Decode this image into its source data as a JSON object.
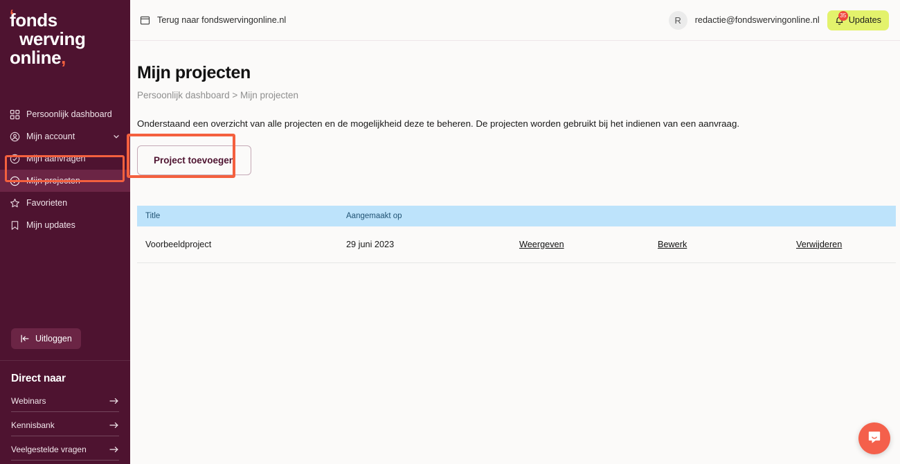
{
  "sidebar": {
    "logo": {
      "line1": "fonds",
      "line2": "werving",
      "line3": "online",
      "comma": ","
    },
    "nav": [
      {
        "label": "Persoonlijk dashboard",
        "icon": "grid-icon"
      },
      {
        "label": "Mijn account",
        "icon": "user-circle-icon",
        "chevron": "chevron-down-icon"
      },
      {
        "label": "Mijn aanvragen",
        "icon": "check-circle-icon"
      },
      {
        "label": "Mijn projecten",
        "icon": "check-circle-icon",
        "active": true
      },
      {
        "label": "Favorieten",
        "icon": "star-icon"
      },
      {
        "label": "Mijn updates",
        "icon": "bookmark-icon"
      }
    ],
    "logout_label": "Uitloggen",
    "direct_title": "Direct naar",
    "direct_links": [
      {
        "label": "Webinars"
      },
      {
        "label": "Kennisbank"
      },
      {
        "label": "Veelgestelde vragen"
      }
    ],
    "colors": {
      "background": "#4e1330",
      "active": "#6b2545",
      "accent": "#f4603e"
    }
  },
  "topbar": {
    "back_label": "Terug naar fondswervingonline.nl",
    "avatar_initial": "R",
    "user_email": "redactie@fondswervingonline.nl",
    "updates_label": "Updates",
    "updates_badge": "35",
    "updates_color": "#e3f26c",
    "badge_color": "#f0483c"
  },
  "main": {
    "title": "Mijn projecten",
    "breadcrumb": "Persoonlijk dashboard > Mijn projecten",
    "lead": "Onderstaand een overzicht van alle projecten en de mogelijkheid deze te beheren. De projecten worden gebruikt bij het indienen van een aanvraag.",
    "add_button_label": "Project toevoegen",
    "highlight_color": "#f4603e",
    "table": {
      "headers": [
        "Title",
        "Aangemaakt op",
        "",
        "",
        ""
      ],
      "rows": [
        {
          "title": "Voorbeeldproject",
          "created": "29 juni 2023",
          "view": "Weergeven",
          "edit": "Bewerk",
          "delete": "Verwijderen"
        }
      ]
    }
  },
  "widgets": {
    "intercom_icon": "chat-bubble-icon",
    "intercom_color": "#f4604b"
  }
}
